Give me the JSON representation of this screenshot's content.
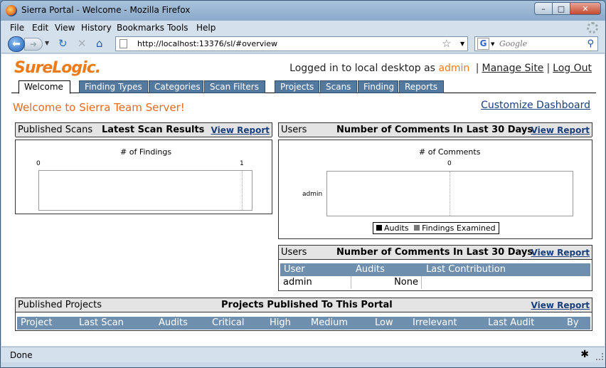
{
  "window": {
    "title": "Sierra Portal - Welcome - Mozilla Firefox"
  },
  "menu": [
    "File",
    "Edit",
    "View",
    "History",
    "Bookmarks",
    "Tools",
    "Help"
  ],
  "address": {
    "url": "http://localhost:13376/sl/#overview"
  },
  "search": {
    "placeholder": "Google",
    "engine_glyph": "G"
  },
  "header": {
    "logo": "SureLogic.",
    "login_prefix": "Logged in to local desktop as",
    "user": "admin",
    "sep": "|",
    "manage_site": "Manage Site",
    "logout": "Log Out"
  },
  "tabs_left": [
    "Welcome",
    "Finding Types",
    "Categories",
    "Scan Filters"
  ],
  "tabs_right": [
    "Projects",
    "Scans",
    "Finding",
    "Reports"
  ],
  "welcome": "Welcome to Sierra Team Server!",
  "customize": "Customize Dashboard",
  "panels": {
    "scans": {
      "category": "Published Scans",
      "title": "Latest Scan Results",
      "view_report": "View Report",
      "chart_title": "# of Findings"
    },
    "users_chart": {
      "category": "Users",
      "title": "Number of Comments In Last 30 Days",
      "view_report": "View Report",
      "chart_title": "# of Comments"
    },
    "users_table": {
      "category": "Users",
      "title": "Number of Comments In Last 30 Days",
      "view_report": "View Report",
      "columns": [
        "User",
        "Audits",
        "Last Contribution"
      ],
      "rows": [
        {
          "user": "admin",
          "audits": "",
          "last": "None"
        }
      ]
    },
    "projects": {
      "category": "Published Projects",
      "title": "Projects Published To This Portal",
      "view_report": "View Report",
      "columns": [
        "Project",
        "Last Scan",
        "Audits",
        "Critical",
        "High",
        "Medium",
        "Low",
        "Irrelevant",
        "Last Audit",
        "By"
      ]
    }
  },
  "chart_data": [
    {
      "type": "bar",
      "title": "# of Findings",
      "categories": [],
      "values": [],
      "xticks": [
        "0",
        "1"
      ],
      "xlim": [
        0,
        1
      ],
      "orientation": "horizontal",
      "grid": true
    },
    {
      "type": "bar",
      "title": "# of Comments",
      "categories": [
        "admin"
      ],
      "series": [
        {
          "name": "Audits",
          "values": [
            0
          ],
          "color": "#000000"
        },
        {
          "name": "Findings Examined",
          "values": [
            0
          ],
          "color": "#777777"
        }
      ],
      "xticks": [
        "0"
      ],
      "orientation": "horizontal",
      "grid": true,
      "legend": "bottom"
    }
  ],
  "status": {
    "text": "Done"
  },
  "colors": {
    "brand": "#ef7a1a",
    "tab": "#54799f",
    "table_head": "#6f8fae",
    "link": "#1a3f7a"
  }
}
